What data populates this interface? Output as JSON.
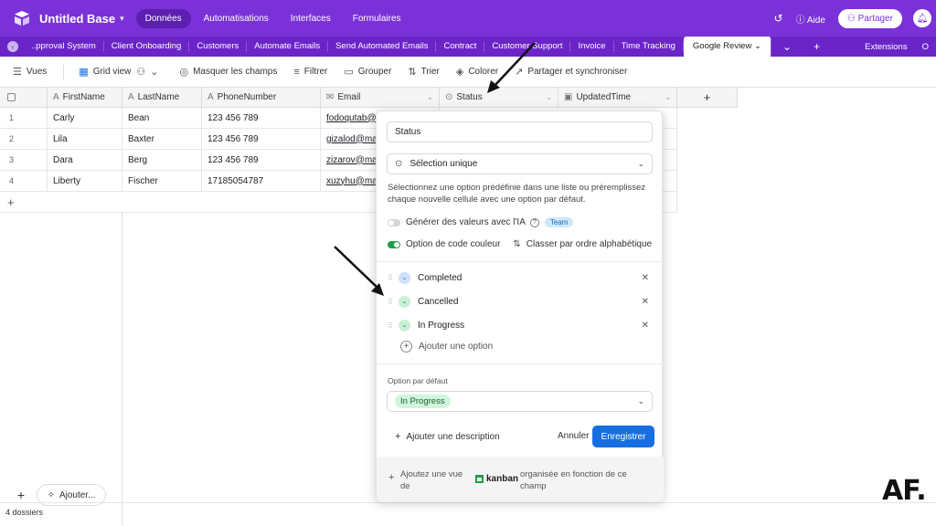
{
  "topbar": {
    "base_title": "Untitled Base",
    "nav": [
      "Données",
      "Automatisations",
      "Interfaces",
      "Formulaires"
    ],
    "help_label": "Aide",
    "share_label": "Partager"
  },
  "tabs": {
    "items": [
      "..pproval System",
      "Client Onboarding",
      "Customers",
      "Automate Emails",
      "Send Automated Emails",
      "Contract",
      "Customer Support",
      "Invoice",
      "Time Tracking"
    ],
    "active": "Google Review",
    "extensions": "Extensions",
    "cut": "O"
  },
  "toolbar": {
    "views": "Vues",
    "grid_view": "Grid view",
    "hide_fields": "Masquer les champs",
    "filter": "Filtrer",
    "group": "Grouper",
    "sort": "Trier",
    "color": "Colorer",
    "share_sync": "Partager et synchroniser"
  },
  "grid": {
    "columns": [
      "FirstName",
      "LastName",
      "PhoneNumber",
      "Email",
      "Status",
      "UpdatedTime"
    ],
    "rows": [
      {
        "num": "1",
        "first": "Carly",
        "last": "Bean",
        "phone": "123 456 789",
        "email": "fodoqutab@mai"
      },
      {
        "num": "2",
        "first": "Lila",
        "last": "Baxter",
        "phone": "123 456 789",
        "email": "gizalod@mai"
      },
      {
        "num": "3",
        "first": "Dara",
        "last": "Berg",
        "phone": "123 456 789",
        "email": "zizarov@mai"
      },
      {
        "num": "4",
        "first": "Liberty",
        "last": "Fischer",
        "phone": "17185054787",
        "email": "xuzyhu@mai"
      }
    ]
  },
  "footer": {
    "add_label": "Ajouter...",
    "folders": "4 dossiers"
  },
  "panel": {
    "field_name": "Status",
    "field_type": "Sélection unique",
    "description": "Sélectionnez une option prédéfinie dans une liste ou préremplissez chaque nouvelle cellule avec une option par défaut.",
    "ai_label": "Générer des valeurs avec l'IA",
    "team_badge": "Team",
    "color_label": "Option de code couleur",
    "sort_label": "Classer par ordre alphabétique",
    "options": [
      {
        "label": "Completed",
        "color": "#cfe0fb",
        "icon_color": "#1a6bb5"
      },
      {
        "label": "Cancelled",
        "color": "#c9f0d6",
        "icon_color": "#1b7a3d"
      },
      {
        "label": "In Progress",
        "color": "#c9f0d6",
        "icon_color": "#1b7a3d"
      }
    ],
    "add_option": "Ajouter une option",
    "default_label": "Option par défaut",
    "default_value": "In Progress",
    "add_description": "Ajouter une description",
    "cancel": "Annuler",
    "save": "Enregistrer",
    "kanban_prefix_1": "Ajoutez une vue",
    "kanban_prefix_2": "de",
    "kanban_name": "kanban",
    "kanban_suffix_1": "organisée en fonction de ce",
    "kanban_suffix_2": "champ"
  },
  "watermark": "AF."
}
